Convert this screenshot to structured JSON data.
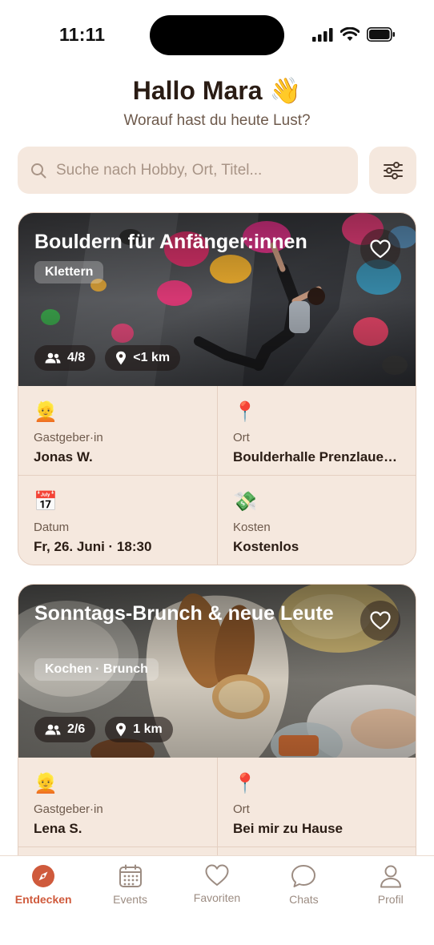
{
  "status_bar": {
    "time": "11:11"
  },
  "header": {
    "greeting": "Hallo Mara 👋",
    "subtitle": "Worauf hast du heute Lust?"
  },
  "search": {
    "placeholder": "Suche nach Hobby, Ort, Titel..."
  },
  "events": [
    {
      "title": "Bouldern für Anfänger:innen",
      "tag": "Klettern",
      "participants": "4/8",
      "distance": "<1 km",
      "host_label": "Gastgeber·in",
      "host": "Jonas W.",
      "place_label": "Ort",
      "place": "Boulderhalle Prenzlauer Berg",
      "date_label": "Datum",
      "date": "Fr, 26. Juni · 18:30",
      "cost_label": "Kosten",
      "cost": "Kostenlos"
    },
    {
      "title": "Sonntags-Brunch & neue Leute",
      "tag": "Kochen · Brunch",
      "participants": "2/6",
      "distance": "1 km",
      "host_label": "Gastgeber·in",
      "host": "Lena S.",
      "place_label": "Ort",
      "place": "Bei mir zu Hause"
    }
  ],
  "tabs": [
    {
      "label": "Entdecken",
      "icon": "compass-icon",
      "active": true
    },
    {
      "label": "Events",
      "icon": "calendar-icon",
      "active": false
    },
    {
      "label": "Favoriten",
      "icon": "heart-icon",
      "active": false
    },
    {
      "label": "Chats",
      "icon": "chat-bubble-icon",
      "active": false
    },
    {
      "label": "Profil",
      "icon": "person-icon",
      "active": false
    }
  ],
  "colors": {
    "accent": "#cf5a3c",
    "card_bg": "#f5e8de",
    "text": "#2a1c14",
    "muted": "#6e5a4c"
  }
}
